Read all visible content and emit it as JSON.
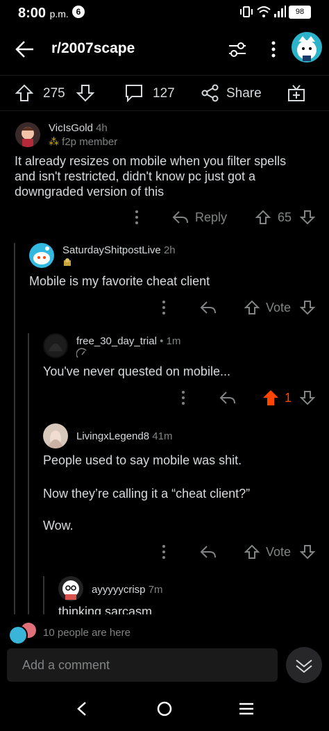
{
  "status_bar": {
    "time": "8:00",
    "ampm": "p.m.",
    "notif_count": "6",
    "battery": "98"
  },
  "header": {
    "title": "r/2007scape"
  },
  "post_actions": {
    "upvotes": "275",
    "comments": "127",
    "share_label": "Share"
  },
  "comments": [
    {
      "user": "VicIsGold",
      "age": "4h",
      "flair": "f2p member",
      "lines": [
        "It already resizes on mobile when you filter spells",
        "and isn't restricted, didn't know pc just got a",
        "downgraded version of this"
      ],
      "reply_label": "Reply",
      "score": "65"
    },
    {
      "user": "SaturdayShitpostLive",
      "age": "2h",
      "text": "Mobile is my favorite cheat client",
      "vote_label": "Vote"
    },
    {
      "user": "free_30_day_trial",
      "age": "1m",
      "text": "You've never quested on mobile...",
      "score": "1"
    },
    {
      "user": "LivingxLegend8",
      "age": "41m",
      "p1": "People used to say mobile was shit.",
      "p2": "Now they’re calling it a “cheat client?”",
      "p3": "Wow.",
      "vote_label": "Vote"
    },
    {
      "user": "ayyyyycrisp",
      "age": "7m",
      "text": "thinking sarcasm"
    }
  ],
  "presence": {
    "text": "10 people are here"
  },
  "composer": {
    "placeholder": "Add a comment"
  },
  "colors": {
    "background": "#000000",
    "text": "#d7dadc",
    "meta": "#818384",
    "upvote_active": "#ff4500"
  }
}
